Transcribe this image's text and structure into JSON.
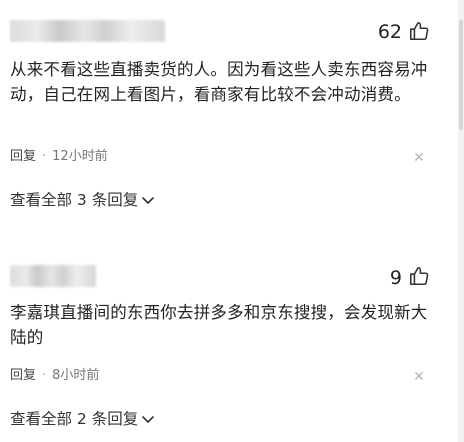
{
  "comments": [
    {
      "likes": "62",
      "text": "从来不看这些直播卖货的人。因为看这些人卖东西容易冲动，自己在网上看图片，看商家有比较不会冲动消费。",
      "reply_label": "回复",
      "time": "12小时前",
      "view_all": "查看全部 3 条回复"
    },
    {
      "likes": "9",
      "text": "李嘉琪直播间的东西你去拼多多和京东搜搜，会发现新大陆的",
      "reply_label": "回复",
      "time": "8小时前",
      "view_all": "查看全部 2 条回复"
    }
  ],
  "icons": {
    "like": "thumbs-up-icon",
    "close": "close-icon",
    "chevron": "chevron-down-icon"
  },
  "colors": {
    "text": "#222222",
    "meta": "#777777",
    "close": "#b5b5b5"
  }
}
